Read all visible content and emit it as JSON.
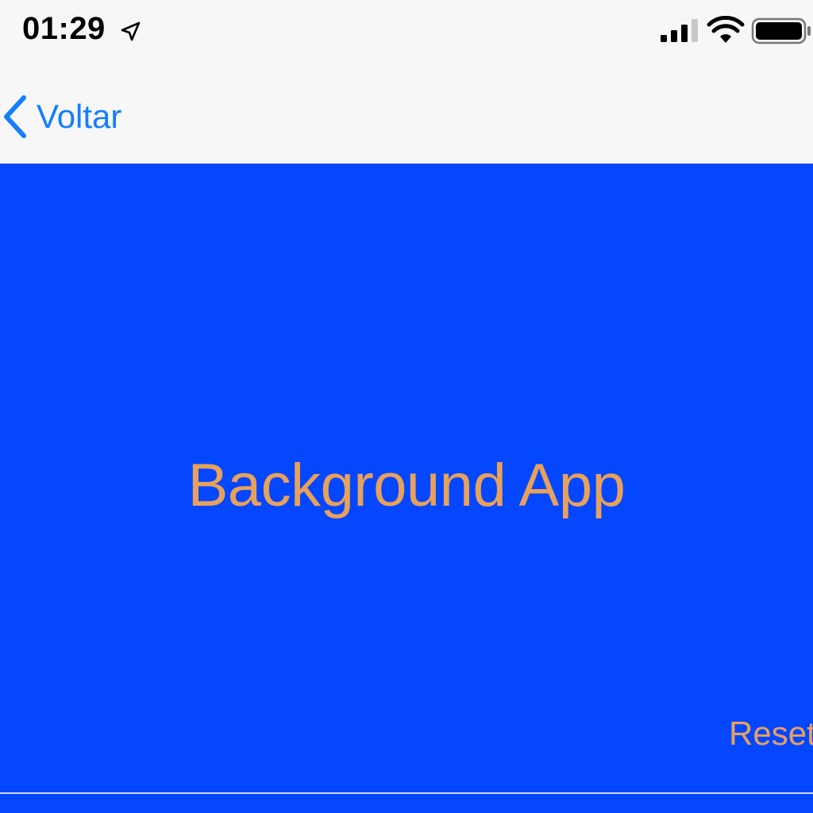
{
  "status_bar": {
    "time": "01:29",
    "icons": [
      "location-arrow-icon",
      "cellular-signal-icon",
      "wifi-icon",
      "battery-icon"
    ]
  },
  "nav": {
    "back_label": "Voltar",
    "back_icon": "chevron-left-icon"
  },
  "main": {
    "title": "Background App",
    "reset_label": "Reset"
  },
  "colors": {
    "background": "#0547ff",
    "text_accent": "#e8a15b",
    "nav_tint": "#147efb",
    "bar_background": "#f7f7f7"
  }
}
